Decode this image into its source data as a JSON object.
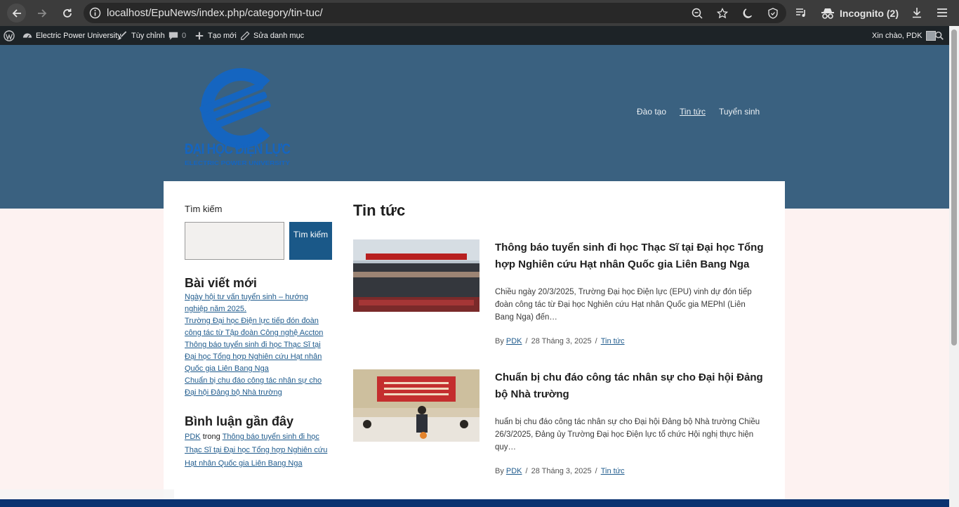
{
  "browser": {
    "url": "localhost/EpuNews/index.php/category/tin-tuc/",
    "incognito_label": "Incognito (2)"
  },
  "admin_bar": {
    "site_name": "Electric Power University",
    "customize": "Tùy chỉnh",
    "comments_count": "0",
    "new": "Tạo mới",
    "edit_category": "Sửa danh mục",
    "greeting": "Xin chào, PDK"
  },
  "header": {
    "logo_title": "ĐẠI HỌC ĐIỆN LỰC",
    "logo_subtitle": "ELECTRIC POWER UNIVERSITY",
    "nav": [
      "Đào tạo",
      "Tin tức",
      "Tuyển sinh"
    ]
  },
  "sidebar": {
    "search_label": "Tìm kiếm",
    "search_value": "",
    "search_button": "Tìm kiếm",
    "recent_posts_title": "Bài viết mới",
    "recent_posts": [
      "Ngày hội tư vấn tuyển sinh – hướng nghiệp năm 2025.",
      "Trường Đại học Điện lực tiếp đón đoàn công tác từ Tập đoàn Công nghệ Accton",
      "Thông báo tuyển sinh đi học Thạc Sĩ tại Đại học Tổng hợp Nghiên cứu Hạt nhân Quốc gia Liên Bang Nga",
      "Chuẩn bị chu đáo công tác nhân sự cho Đại hội Đảng bộ Nhà trường"
    ],
    "recent_comments_title": "Bình luận gần đây",
    "comment": {
      "author": "PDK",
      "connector": "trong",
      "post": "Thông báo tuyển sinh đi học Thạc Sĩ tại Đại học Tổng hợp Nghiên cứu Hạt nhân Quốc gia Liên Bang Nga"
    }
  },
  "archive": {
    "title": "Tin tức",
    "posts": [
      {
        "title": "Thông báo tuyển sinh đi học Thạc Sĩ tại Đại học Tổng hợp Nghiên cứu Hạt nhân Quốc gia Liên Bang Nga",
        "excerpt": "Chiều ngày 20/3/2025, Trường Đại học Điện lực (EPU) vinh dự đón tiếp đoàn công tác từ Đại học Nghiên cứu Hạt nhân Quốc gia MEPhI (Liên Bang Nga) đến…",
        "by": "By",
        "author": "PDK",
        "date": "28 Tháng 3, 2025",
        "category": "Tin tức"
      },
      {
        "title": "Chuẩn bị chu đáo công tác nhân sự cho Đại hội Đảng bộ Nhà trường",
        "excerpt": "huẩn bị chu đáo công tác nhân sự cho Đại hội Đảng bộ Nhà trường Chiều 26/3/2025, Đảng ủy Trường Đại học Điện lực tổ chức Hội nghị thực hiện quy…",
        "by": "By",
        "author": "PDK",
        "date": "28 Tháng 3, 2025",
        "category": "Tin tức"
      }
    ]
  },
  "colors": {
    "header_bg": "#3a6180",
    "logo_blue": "#1565c0",
    "button_bg": "#1a5888",
    "link": "#1f5b8d",
    "page_bg": "#fdf2f1",
    "footer": "#0a3270"
  }
}
